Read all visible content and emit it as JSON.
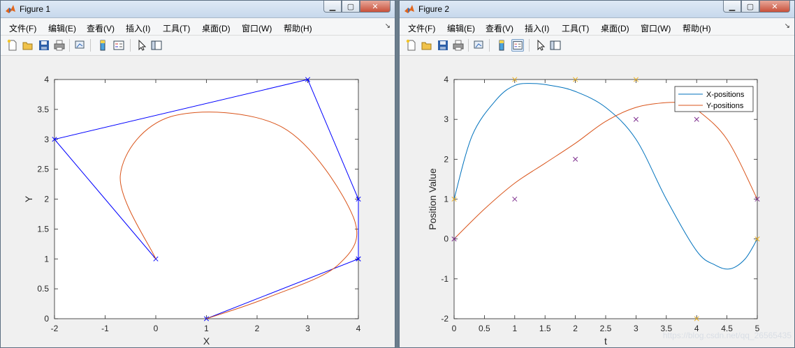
{
  "figure1": {
    "title": "Figure 1",
    "menu": [
      "文件(F)",
      "编辑(E)",
      "查看(V)",
      "插入(I)",
      "工具(T)",
      "桌面(D)",
      "窗口(W)",
      "帮助(H)"
    ],
    "toolbar_icons": [
      "new-figure-icon",
      "open-file-icon",
      "save-icon",
      "print-icon",
      "link-plot-icon",
      "colorbar-icon",
      "legend-icon",
      "edit-plot-icon",
      "property-inspector-icon"
    ]
  },
  "figure2": {
    "title": "Figure 2",
    "menu": [
      "文件(F)",
      "编辑(E)",
      "查看(V)",
      "插入(I)",
      "工具(T)",
      "桌面(D)",
      "窗口(W)",
      "帮助(H)"
    ],
    "toolbar_icons": [
      "new-figure-icon",
      "open-file-icon",
      "save-icon",
      "print-icon",
      "link-plot-icon",
      "colorbar-icon",
      "legend-icon",
      "edit-plot-icon",
      "property-inspector-icon"
    ]
  },
  "watermark": "https://blog.csdn.net/qq_26565435",
  "colors": {
    "control": "#0000ff",
    "curve": "#d95319",
    "x_series": "#0072bd",
    "x_marker": "#edb120",
    "y_marker": "#7e2f8e"
  },
  "chart_data": [
    {
      "type": "line",
      "xlabel": "X",
      "ylabel": "Y",
      "xlim": [
        -2,
        4
      ],
      "ylim": [
        0,
        4
      ],
      "xticks": [
        "-2",
        "-1",
        "0",
        "1",
        "2",
        "3",
        "4"
      ],
      "yticks": [
        "0",
        "0.5",
        "1",
        "1.5",
        "2",
        "2.5",
        "3",
        "3.5",
        "4"
      ],
      "grid": false,
      "series": [
        {
          "role": "control-polygon",
          "x": [
            0,
            -2,
            3,
            4,
            4,
            4,
            1
          ],
          "y": [
            1,
            3,
            4,
            2,
            1,
            1,
            0
          ]
        },
        {
          "role": "spline-curve",
          "x": [
            0,
            -0.7,
            0.3,
            2.5,
            3.9,
            3.6,
            2.2,
            1
          ],
          "y": [
            1,
            2.4,
            3.38,
            3.2,
            1.7,
            0.9,
            0.35,
            0
          ]
        }
      ]
    },
    {
      "type": "line",
      "xlabel": "t",
      "ylabel": "Position Value",
      "xlim": [
        0,
        5
      ],
      "ylim": [
        -2,
        4
      ],
      "xticks": [
        "0",
        "0.5",
        "1",
        "1.5",
        "2",
        "2.5",
        "3",
        "3.5",
        "4",
        "4.5",
        "5"
      ],
      "yticks": [
        "-2",
        "-1",
        "0",
        "1",
        "2",
        "3",
        "4"
      ],
      "legend_position": "top-right",
      "series": [
        {
          "name": "X-positions",
          "x": [
            0,
            0.3,
            0.7,
            1.0,
            1.3,
            1.6,
            2.0,
            2.5,
            3.0,
            3.5,
            4.0,
            4.3,
            4.55,
            4.8,
            5.0
          ],
          "y": [
            1,
            2.6,
            3.5,
            3.85,
            3.9,
            3.85,
            3.7,
            3.3,
            2.5,
            1.0,
            -0.3,
            -0.65,
            -0.75,
            -0.5,
            0
          ]
        },
        {
          "name": "Y-positions",
          "x": [
            0,
            0.5,
            1.0,
            1.5,
            2.0,
            2.5,
            3.0,
            3.5,
            3.8,
            4.0,
            4.5,
            5.0
          ],
          "y": [
            0,
            0.75,
            1.4,
            1.9,
            2.4,
            2.95,
            3.3,
            3.42,
            3.4,
            3.25,
            2.5,
            1.0
          ]
        },
        {
          "role": "x-control-points",
          "x": [
            0,
            1,
            2,
            3,
            4,
            5
          ],
          "y": [
            1,
            4,
            4,
            4,
            -2,
            0
          ]
        },
        {
          "role": "y-control-points",
          "x": [
            0,
            1,
            2,
            3,
            4,
            5
          ],
          "y": [
            0,
            1,
            2,
            3,
            3,
            1
          ]
        }
      ]
    }
  ]
}
